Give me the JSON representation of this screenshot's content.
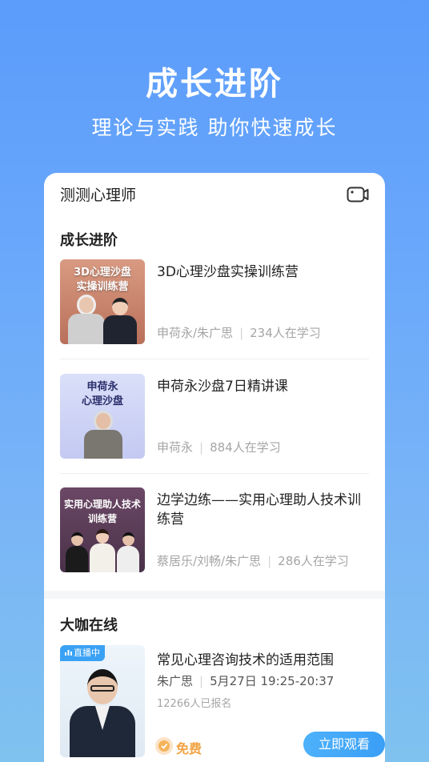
{
  "hero": {
    "title": "成长进阶",
    "subtitle": "理论与实践 助你快速成长"
  },
  "card": {
    "app_name": "测测心理师",
    "camera_icon": "camera-icon"
  },
  "growth_section": {
    "title": "成长进阶",
    "courses": [
      {
        "thumb_title_line1": "3D心理沙盘",
        "thumb_title_line2": "实操训练营",
        "title": "3D心理沙盘实操训练营",
        "teachers": "申荷永/朱广思",
        "learners": "234人在学习",
        "thumb_color": "#c9846d"
      },
      {
        "thumb_title_line1": "申荷永",
        "thumb_title_line2": "心理沙盘",
        "title": "申荷永沙盘7日精讲课",
        "teachers": "申荷永",
        "learners": "884人在学习",
        "thumb_color": "#cfd4f6"
      },
      {
        "thumb_title_line1": "实用心理助人技术",
        "thumb_title_line2": "训练营",
        "title": "边学边练——实用心理助人技术训练营",
        "teachers": "蔡居乐/刘畅/朱广思",
        "learners": "286人在学习",
        "thumb_color": "#5a3d58"
      }
    ]
  },
  "live_section": {
    "title": "大咖在线",
    "item": {
      "badge": "直播中",
      "title": "常见心理咨询技术的适用范围",
      "speaker": "朱广思",
      "time": "5月27日 19:25-20:37",
      "signups": "12266人已报名",
      "price_label": "免费",
      "watch_label": "立即观看"
    }
  }
}
